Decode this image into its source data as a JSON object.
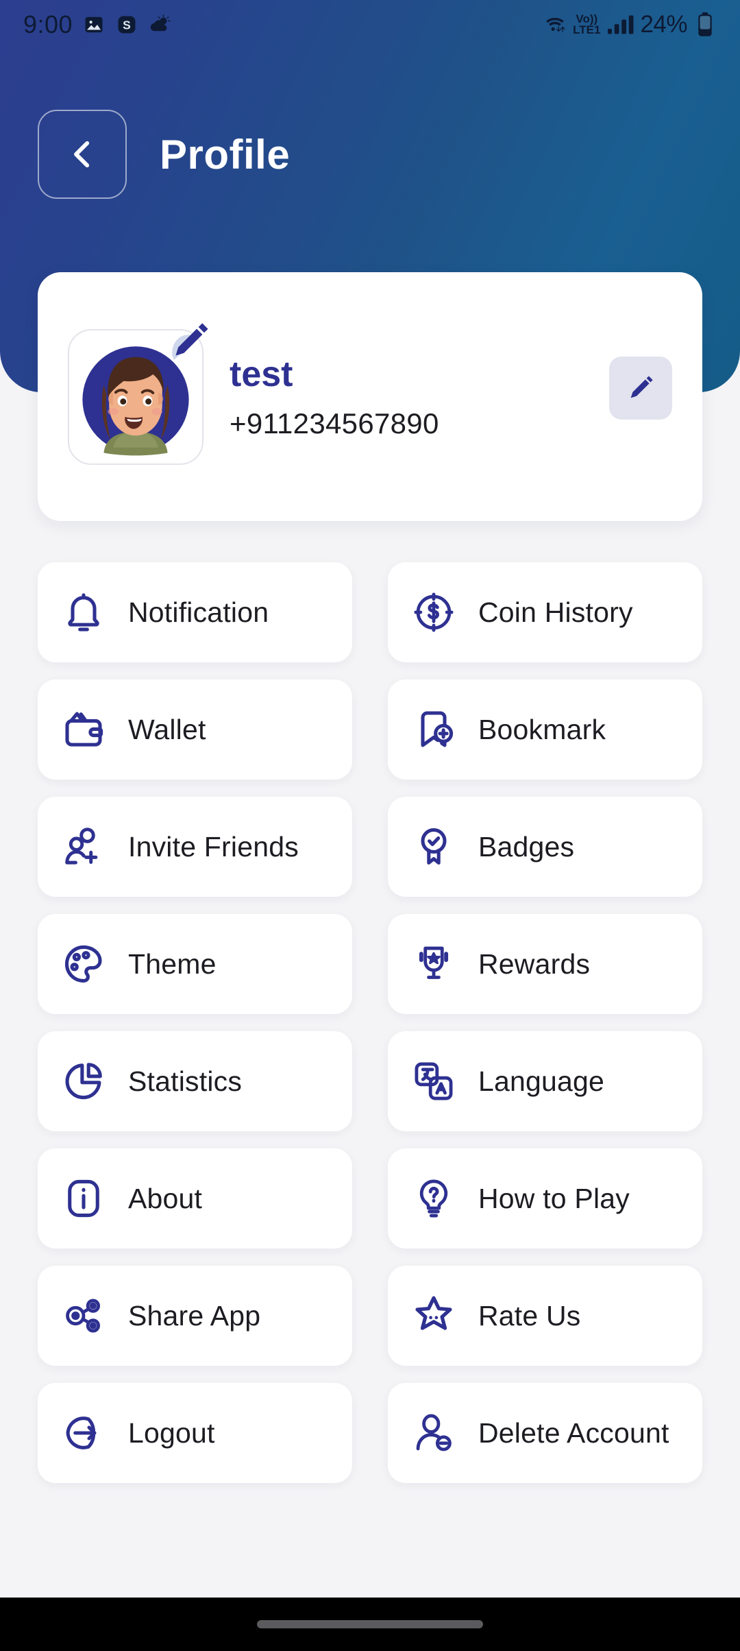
{
  "status_bar": {
    "time": "9:00",
    "left_icons": [
      "image-icon",
      "skype-icon",
      "weather-icon"
    ],
    "network_label_top": "Vo))",
    "network_label_bottom": "LTE1",
    "battery_percent": "24%",
    "right_icons": [
      "wifi-icon",
      "signal-icon",
      "battery-icon"
    ]
  },
  "app_bar": {
    "back_icon": "chevron-left-icon",
    "title": "Profile"
  },
  "profile": {
    "avatar_icon": "user-avatar",
    "avatar_badge_icon": "pencil-badge-icon",
    "name": "test",
    "phone": "+911234567890",
    "edit_button_icon": "pencil-icon"
  },
  "menu": {
    "items": [
      {
        "label": "Notification",
        "icon": "bell-icon"
      },
      {
        "label": "Coin History",
        "icon": "coin-dollar-icon"
      },
      {
        "label": "Wallet",
        "icon": "wallet-icon"
      },
      {
        "label": "Bookmark",
        "icon": "bookmark-plus-icon"
      },
      {
        "label": "Invite Friends",
        "icon": "users-plus-icon"
      },
      {
        "label": "Badges",
        "icon": "badge-check-icon"
      },
      {
        "label": "Theme",
        "icon": "palette-icon"
      },
      {
        "label": "Rewards",
        "icon": "trophy-star-icon"
      },
      {
        "label": "Statistics",
        "icon": "pie-chart-icon"
      },
      {
        "label": "Language",
        "icon": "translate-icon"
      },
      {
        "label": "About",
        "icon": "info-icon"
      },
      {
        "label": "How to Play",
        "icon": "bulb-question-icon"
      },
      {
        "label": "Share App",
        "icon": "share-nodes-icon"
      },
      {
        "label": "Rate Us",
        "icon": "star-icon"
      },
      {
        "label": "Logout",
        "icon": "logout-icon"
      },
      {
        "label": "Delete Account",
        "icon": "user-minus-icon"
      }
    ]
  },
  "navigation_bar": {
    "home_indicator": "home-indicator-pill"
  },
  "colors": {
    "header_blue_start": "#2c3e8f",
    "header_blue_end": "#155c88",
    "icon_navy": "#2e3191",
    "name_blue": "#2e3191",
    "text_dark": "#1c1c22",
    "page_bg": "#f4f4f6",
    "card_white": "#ffffff",
    "edit_btn_bg": "#e2e3ee"
  }
}
